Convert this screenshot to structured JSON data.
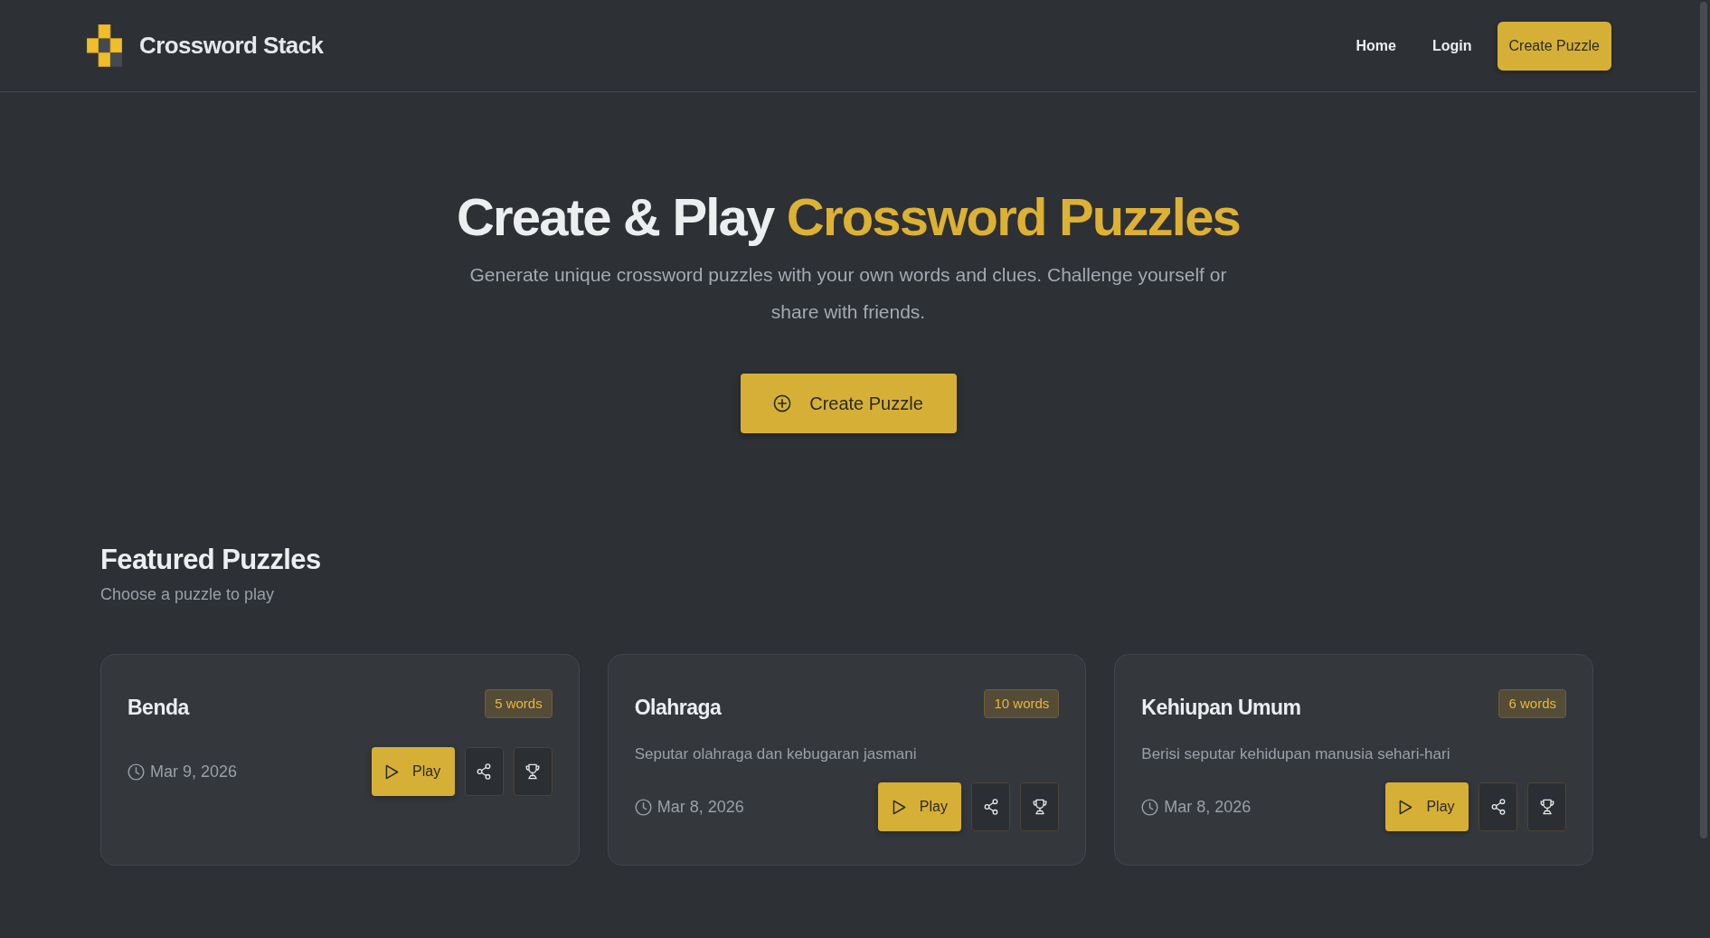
{
  "header": {
    "brand": "Crossword Stack",
    "nav": [
      {
        "label": "Home"
      },
      {
        "label": "Login"
      }
    ],
    "cta": "Create Puzzle"
  },
  "hero": {
    "title": "Create & Play",
    "title_accent": "Crossword Puzzles",
    "subtitle": "Generate unique crossword puzzles with your own words and clues. Challenge yourself or share with friends.",
    "button": "Create Puzzle"
  },
  "featured": {
    "title": "Featured Puzzles",
    "subtitle": "Choose a puzzle to play",
    "puzzles": [
      {
        "title": "Benda",
        "badge": "5 words",
        "date": "Mar 9, 2026",
        "play": "Play"
      },
      {
        "title": "Olahraga",
        "badge": "10 words",
        "description": "Seputar olahraga dan kebugaran jasmani",
        "date": "Mar 8, 2026",
        "play": "Play"
      },
      {
        "title": "Kehiupan Umum",
        "badge": "6 words",
        "description": "Berisi seputar kehidupan manusia sehari-hari",
        "date": "Mar 8, 2026",
        "play": "Play"
      }
    ]
  }
}
